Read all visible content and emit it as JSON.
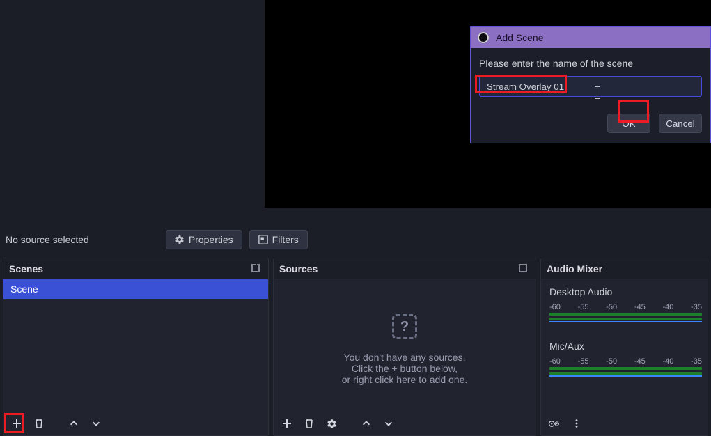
{
  "dialog": {
    "title": "Add Scene",
    "prompt": "Please enter the name of the scene",
    "input_value": "Stream Overlay 01",
    "ok_label": "OK",
    "cancel_label": "Cancel"
  },
  "toolbar": {
    "status_text": "No source selected",
    "properties_label": "Properties",
    "filters_label": "Filters"
  },
  "panels": {
    "scenes_title": "Scenes",
    "sources_title": "Sources",
    "mixer_title": "Audio Mixer"
  },
  "scenes": {
    "items": [
      "Scene"
    ]
  },
  "sources_empty": {
    "line1": "You don't have any sources.",
    "line2": "Click the + button below,",
    "line3": "or right click here to add one."
  },
  "mixer": {
    "ticks": [
      "-60",
      "-55",
      "-50",
      "-45",
      "-40",
      "-35"
    ],
    "channels": [
      {
        "name": "Desktop Audio"
      },
      {
        "name": "Mic/Aux"
      }
    ]
  }
}
